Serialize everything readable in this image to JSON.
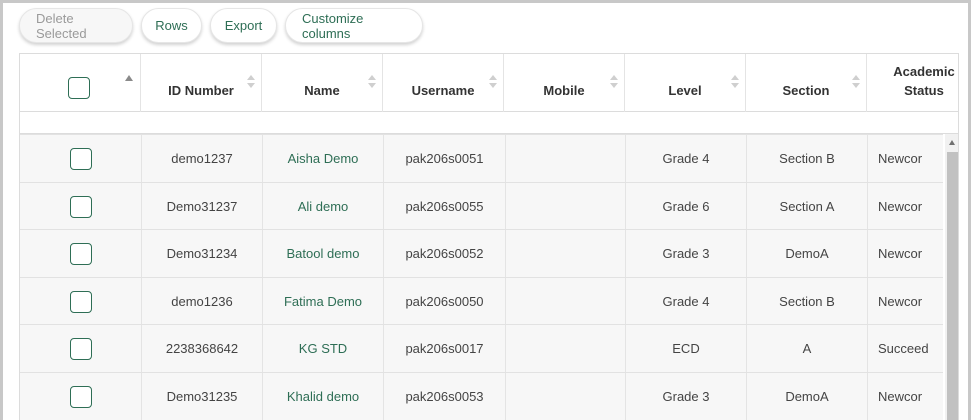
{
  "toolbar": {
    "delete_selected": "Delete Selected",
    "rows": "Rows",
    "export": "Export",
    "customize_columns": "Customize columns"
  },
  "columns": {
    "id_number": "ID Number",
    "name": "Name",
    "username": "Username",
    "mobile": "Mobile",
    "level": "Level",
    "section": "Section",
    "academic_status": "Academic Status"
  },
  "rows": [
    {
      "id": "demo1237",
      "name": "Aisha Demo",
      "username": "pak206s0051",
      "mobile": "",
      "level": "Grade 4",
      "section": "Section B",
      "status": "Newcor"
    },
    {
      "id": "Demo31237",
      "name": "Ali demo",
      "username": "pak206s0055",
      "mobile": "",
      "level": "Grade 6",
      "section": "Section A",
      "status": "Newcor"
    },
    {
      "id": "Demo31234",
      "name": "Batool demo",
      "username": "pak206s0052",
      "mobile": "",
      "level": "Grade 3",
      "section": "DemoA",
      "status": "Newcor"
    },
    {
      "id": "demo1236",
      "name": "Fatima Demo",
      "username": "pak206s0050",
      "mobile": "",
      "level": "Grade 4",
      "section": "Section B",
      "status": "Newcor"
    },
    {
      "id": "2238368642",
      "name": "KG STD",
      "username": "pak206s0017",
      "mobile": "",
      "level": "ECD",
      "section": "A",
      "status": "Succeed"
    },
    {
      "id": "Demo31235",
      "name": "Khalid demo",
      "username": "pak206s0053",
      "mobile": "",
      "level": "Grade 3",
      "section": "DemoA",
      "status": "Newcor"
    }
  ],
  "icons": {
    "sort": "sort-both-icon",
    "sort_up": "sort-ascending-icon",
    "scroll_up": "scroll-up-arrow-icon"
  },
  "colors": {
    "accent": "#2e6e55",
    "row_bg": "#f7f7f7",
    "border": "#dcdcdc"
  }
}
